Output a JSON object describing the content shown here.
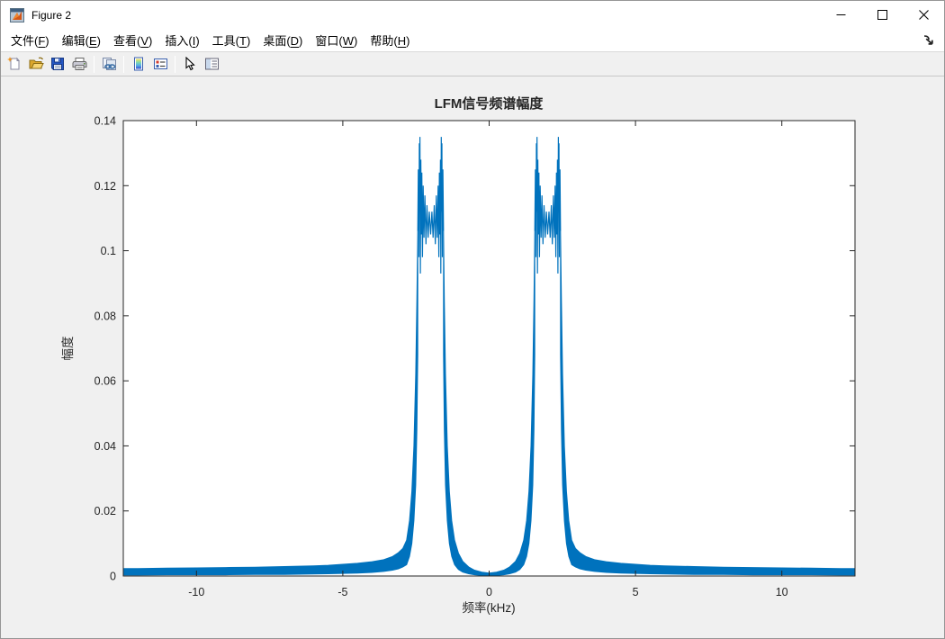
{
  "window": {
    "title": "Figure 2",
    "controls": [
      "minimize",
      "maximize",
      "close"
    ]
  },
  "menu": {
    "items": [
      {
        "label": "文件",
        "mnemonic": "F"
      },
      {
        "label": "编辑",
        "mnemonic": "E"
      },
      {
        "label": "查看",
        "mnemonic": "V"
      },
      {
        "label": "插入",
        "mnemonic": "I"
      },
      {
        "label": "工具",
        "mnemonic": "T"
      },
      {
        "label": "桌面",
        "mnemonic": "D"
      },
      {
        "label": "窗口",
        "mnemonic": "W"
      },
      {
        "label": "帮助",
        "mnemonic": "H"
      }
    ],
    "dock_icon": "dock-figure-icon"
  },
  "toolbar": {
    "icons": [
      "new-figure-icon",
      "open-file-icon",
      "save-figure-icon",
      "print-figure-icon",
      "separator",
      "link-plot-icon",
      "separator",
      "insert-colorbar-icon",
      "insert-legend-icon",
      "separator",
      "edit-plot-icon",
      "property-inspector-icon"
    ]
  },
  "chart_data": {
    "type": "line",
    "title": "LFM信号频谱幅度",
    "xlabel": "频率(kHz)",
    "ylabel": "幅度",
    "xlim": [
      -12.5,
      12.5
    ],
    "ylim": [
      0,
      0.14
    ],
    "xticks": [
      -10,
      -5,
      0,
      5,
      10
    ],
    "xtick_labels": [
      "-10",
      "-5",
      "0",
      "5",
      "10"
    ],
    "yticks": [
      0,
      0.02,
      0.04,
      0.06,
      0.08,
      0.1,
      0.12,
      0.14
    ],
    "ytick_labels": [
      "0",
      "0.02",
      "0.04",
      "0.06",
      "0.08",
      "0.1",
      "0.12",
      "0.14"
    ],
    "grid": false,
    "legend": null,
    "line_color": "#0072BD",
    "axes_color": "#262626",
    "plot_bg": "#ffffff",
    "figure_bg": "#f0f0f0",
    "description": "Magnitude spectrum of a real LFM (chirp) signal: two symmetric bands centered at ±2 kHz (≈1.56–2.44 kHz wide) with Fresnel ripples, edge spikes ≈0.135, in-band level ≈0.105–0.12, near-zero valley at 0 kHz and decaying oscillatory tails to ±12.5 kHz.",
    "curve": {
      "band_center_khz": 2.0,
      "peak": 0.135,
      "valley": [
        [
          0,
          0.0009,
          0.0001
        ],
        [
          0.25,
          0.0012,
          0.0002
        ],
        [
          0.5,
          0.0018,
          0.0004
        ],
        [
          0.7,
          0.0028,
          0.0007
        ],
        [
          0.9,
          0.0045,
          0.0012
        ],
        [
          1.05,
          0.007,
          0.002
        ],
        [
          1.18,
          0.011,
          0.0035
        ],
        [
          1.28,
          0.017,
          0.006
        ],
        [
          1.36,
          0.026,
          0.01
        ],
        [
          1.43,
          0.04,
          0.017
        ],
        [
          1.49,
          0.062,
          0.028
        ],
        [
          1.53,
          0.085,
          0.045
        ],
        [
          1.56,
          0.106,
          0.068
        ]
      ],
      "band": [
        [
          1.56,
          0.106
        ],
        [
          1.58,
          0.125
        ],
        [
          1.6,
          0.098
        ],
        [
          1.615,
          0.133
        ],
        [
          1.625,
          0.112
        ],
        [
          1.635,
          0.135
        ],
        [
          1.65,
          0.093
        ],
        [
          1.665,
          0.128
        ],
        [
          1.685,
          0.105
        ],
        [
          1.7,
          0.124
        ],
        [
          1.72,
          0.098
        ],
        [
          1.745,
          0.12
        ],
        [
          1.775,
          0.104
        ],
        [
          1.805,
          0.117
        ],
        [
          1.84,
          0.102
        ],
        [
          1.875,
          0.114
        ],
        [
          1.915,
          0.104
        ],
        [
          1.955,
          0.112
        ],
        [
          2.0,
          0.105
        ],
        [
          2.045,
          0.112
        ],
        [
          2.085,
          0.104
        ],
        [
          2.125,
          0.114
        ],
        [
          2.16,
          0.102
        ],
        [
          2.195,
          0.117
        ],
        [
          2.225,
          0.104
        ],
        [
          2.255,
          0.12
        ],
        [
          2.28,
          0.098
        ],
        [
          2.3,
          0.124
        ],
        [
          2.315,
          0.105
        ],
        [
          2.335,
          0.128
        ],
        [
          2.35,
          0.093
        ],
        [
          2.365,
          0.135
        ],
        [
          2.375,
          0.112
        ],
        [
          2.385,
          0.133
        ],
        [
          2.4,
          0.098
        ],
        [
          2.42,
          0.125
        ],
        [
          2.44,
          0.106
        ]
      ],
      "outer": [
        [
          2.44,
          0.106,
          0.068
        ],
        [
          2.47,
          0.085,
          0.045
        ],
        [
          2.51,
          0.062,
          0.028
        ],
        [
          2.57,
          0.04,
          0.017
        ],
        [
          2.64,
          0.026,
          0.01
        ],
        [
          2.72,
          0.017,
          0.006
        ],
        [
          2.82,
          0.011,
          0.0035
        ],
        [
          2.95,
          0.0085,
          0.0028
        ],
        [
          3.1,
          0.0072,
          0.0022
        ],
        [
          3.3,
          0.006,
          0.0018
        ],
        [
          3.6,
          0.005,
          0.0014
        ],
        [
          4.0,
          0.0044,
          0.0011
        ],
        [
          4.5,
          0.0039,
          0.0009
        ],
        [
          5.0,
          0.0036,
          0.0008
        ],
        [
          5.5,
          0.0033,
          0.0007
        ],
        [
          6.0,
          0.0031,
          0.0006
        ],
        [
          7.0,
          0.0029,
          0.0005
        ],
        [
          8.0,
          0.0027,
          0.0005
        ],
        [
          9.0,
          0.0026,
          0.0004
        ],
        [
          10.0,
          0.0025,
          0.0004
        ],
        [
          11.0,
          0.0024,
          0.0004
        ],
        [
          12.0,
          0.0023,
          0.0003
        ],
        [
          12.5,
          0.0023,
          0.0003
        ]
      ]
    }
  }
}
